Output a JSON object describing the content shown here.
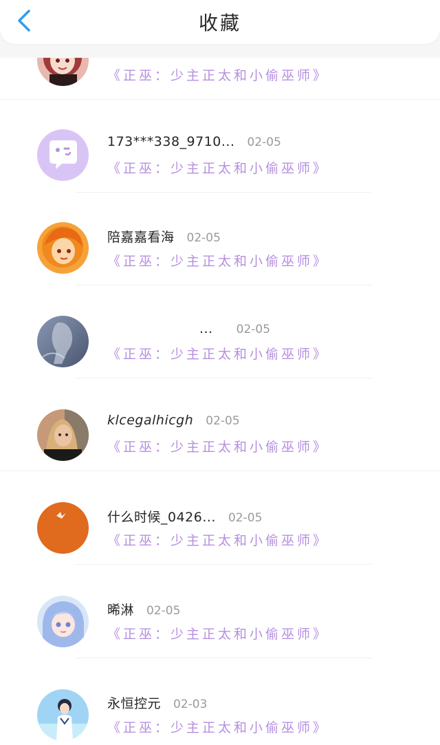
{
  "header": {
    "title": "收藏",
    "back_icon": "chevron-left-icon",
    "accent_color": "#2f9cf0"
  },
  "colors": {
    "book_title": "#b58fe0",
    "date": "#9a9a9a"
  },
  "favorites": [
    {
      "name": "",
      "date": "",
      "book": "《正巫：少主正太和小偷巫师》",
      "avatar": "anime-girl-red-hair"
    },
    {
      "name": "173***338_9710...",
      "date": "02-05",
      "book": "《正巫：少主正太和小偷巫师》",
      "avatar": "default-chat-bubble"
    },
    {
      "name": "陪嘉嘉看海",
      "date": "02-05",
      "book": "《正巫：少主正太和小偷巫师》",
      "avatar": "orange-anime-character"
    },
    {
      "name": "...",
      "date": "02-05",
      "book": "《正巫：少主正太和小偷巫师》",
      "avatar": "blue-grey-photo"
    },
    {
      "name": "klcegalhicgh",
      "date": "02-05",
      "book": "《正巫：少主正太和小偷巫师》",
      "avatar": "blonde-woman-photo"
    },
    {
      "name": "什么时候_0426...",
      "date": "02-05",
      "book": "《正巫：少主正太和小偷巫师》",
      "avatar": "orange-sky-bird"
    },
    {
      "name": "晞淋",
      "date": "02-05",
      "book": "《正巫：少主正太和小偷巫师》",
      "avatar": "blue-hair-anime-girl"
    },
    {
      "name": "永恒控元",
      "date": "02-03",
      "book": "《正巫：少主正太和小偷巫师》",
      "avatar": "anime-boy-sky"
    }
  ]
}
